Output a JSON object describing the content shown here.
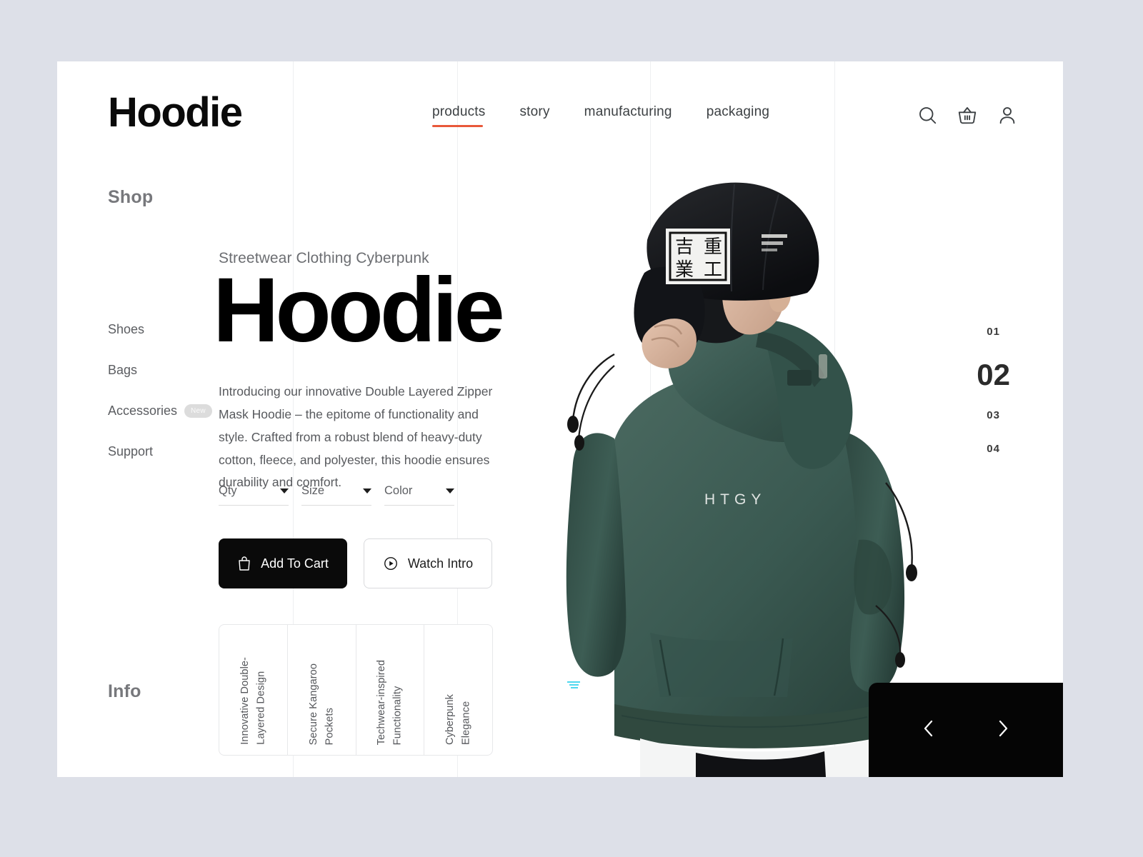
{
  "theme": {
    "page_background": "#dde0e8",
    "canvas_background": "#ffffff",
    "accent": "#e8583a",
    "ink": "#0a0a0a",
    "muted": "#57595d",
    "hoodie_color": "#3c5a53"
  },
  "header": {
    "brand": "Hoodie",
    "nav": [
      {
        "label": "products",
        "active": true
      },
      {
        "label": "story",
        "active": false
      },
      {
        "label": "manufacturing",
        "active": false
      },
      {
        "label": "packaging",
        "active": false
      }
    ],
    "icons": [
      {
        "name": "search-icon",
        "label": "Search"
      },
      {
        "name": "basket-icon",
        "label": "Cart"
      },
      {
        "name": "user-icon",
        "label": "Account"
      }
    ]
  },
  "sidebar": {
    "shop_title": "Shop",
    "info_title": "Info",
    "items": [
      {
        "label": "Shoes",
        "badge": ""
      },
      {
        "label": "Bags",
        "badge": ""
      },
      {
        "label": "Accessories",
        "badge": "New"
      },
      {
        "label": "Support",
        "badge": ""
      }
    ]
  },
  "product": {
    "eyebrow": "Streetwear Clothing Cyberpunk",
    "headline": "Hoodie",
    "description": "Introducing our innovative Double Layered Zipper Mask Hoodie – the epitome of functionality and style. Crafted from a robust blend of heavy-duty cotton, fleece, and polyester, this hoodie ensures durability and comfort.",
    "selects": [
      {
        "label": "Qty"
      },
      {
        "label": "Size"
      },
      {
        "label": "Color"
      }
    ],
    "primary_button": "Add To Cart",
    "secondary_button": "Watch Intro",
    "features": [
      {
        "label": "Innovative Double-\nLayered Design"
      },
      {
        "label": "Secure Kangaroo\nPockets"
      },
      {
        "label": "Techwear-inspired\nFunctionality"
      },
      {
        "label": "Cyberpunk\nElegance"
      }
    ],
    "photo": {
      "cap_text": "吉重\n業工",
      "hoodie_text": "HTGY"
    }
  },
  "pagination": {
    "items": [
      {
        "label": "01",
        "active": false
      },
      {
        "label": "02",
        "active": true
      },
      {
        "label": "03",
        "active": false
      },
      {
        "label": "04",
        "active": false
      }
    ]
  },
  "slider_nav": {
    "prev_label": "Previous",
    "next_label": "Next"
  }
}
